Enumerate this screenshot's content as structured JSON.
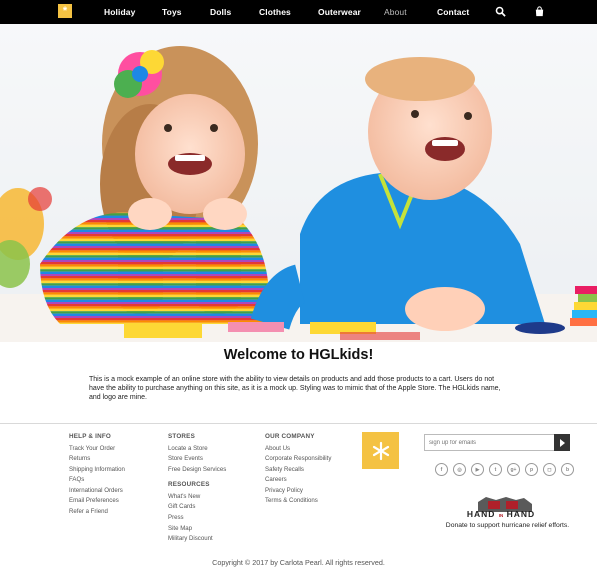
{
  "nav": {
    "logo_glyph": "*",
    "items": [
      "Holiday",
      "Toys",
      "Dolls",
      "Clothes",
      "Outerwear",
      "About",
      "Contact"
    ],
    "icons": [
      "search-icon",
      "bag-icon"
    ]
  },
  "welcome": {
    "title": "Welcome to HGLkids!",
    "text": "This is a mock example of an online store with the ability to view details on products and add those products to a cart. Users do not have the ability to purchase anything on this site, as it is a mock up. Styling was to mimic that of the Apple Store. The HGLkids name, and logo are mine."
  },
  "footer": {
    "help": {
      "heading": "HELP & INFO",
      "links": [
        "Track Your Order",
        "Returns",
        "Shipping Information",
        "FAQs",
        "International Orders",
        "Email Preferences",
        "Refer a Friend"
      ]
    },
    "stores": {
      "heading": "STORES",
      "links": [
        "Locate a Store",
        "Store Events",
        "Free Design Services"
      ]
    },
    "resources": {
      "heading": "RESOURCES",
      "links": [
        "What's New",
        "Gift Cards",
        "Press",
        "Site Map",
        "Military Discount"
      ]
    },
    "company": {
      "heading": "OUR COMPANY",
      "links": [
        "About Us",
        "Corporate Responsibility",
        "Safety Recalls",
        "Careers",
        "Privacy Policy",
        "Terms & Conditions"
      ]
    },
    "signup_placeholder": "sign up for emails",
    "socials": [
      "facebook-icon",
      "instagram-icon",
      "youtube-icon",
      "twitter-icon",
      "google-plus-icon",
      "pinterest-icon",
      "instagram-alt-icon",
      "blog-icon"
    ],
    "partner": {
      "name_left": "HAND",
      "name_mid": "IN",
      "name_right": "HAND",
      "tagline": "Donate to support hurricane relief efforts."
    },
    "copyright": "Copyright © 2017 by Carlota Pearl. All rights reserved."
  },
  "colors": {
    "nav_bg": "#000000",
    "brand_yellow": "#f4c243",
    "partner_red": "#b0202a"
  }
}
